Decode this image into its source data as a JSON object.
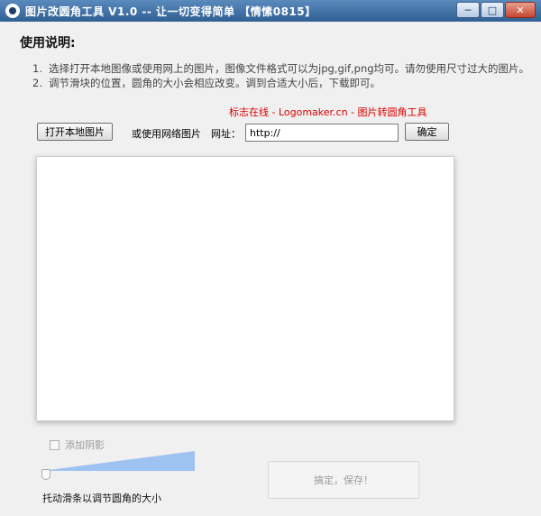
{
  "window": {
    "title": "图片改圆角工具 V1.0  -- 让一切变得简单 【情愫0815】",
    "minimize_glyph": "─",
    "maximize_glyph": "□",
    "close_glyph": "✕"
  },
  "section_title": "使用说明:",
  "instructions": [
    {
      "num": "1.",
      "text": "选择打开本地图像或使用网上的图片，图像文件格式可以为jpg,gif,png均可。请勿使用尺寸过大的图片。"
    },
    {
      "num": "2.",
      "text": "调节滑块的位置，圆角的大小会相应改变。调到合适大小后，下载即可。"
    }
  ],
  "promo_text": "标志在线 - Logomaker.cn - 图片转圆角工具",
  "toolbar": {
    "open_local_label": "打开本地图片",
    "or_web_label": "或使用网络图片",
    "url_label": "网址：",
    "url_value": "http://",
    "confirm_label": "确定"
  },
  "options": {
    "shadow_label": "添加阴影",
    "shadow_checked": false
  },
  "slider": {
    "caption": "托动滑条以调节圆角的大小",
    "value_fraction": 0.0
  },
  "save_button_label": "搞定，保存！",
  "colors": {
    "titlebar_start": "#5b8bbd",
    "titlebar_end": "#2f5f93",
    "promo": "#dd0000",
    "slider_fill": "#9ec3f2"
  }
}
